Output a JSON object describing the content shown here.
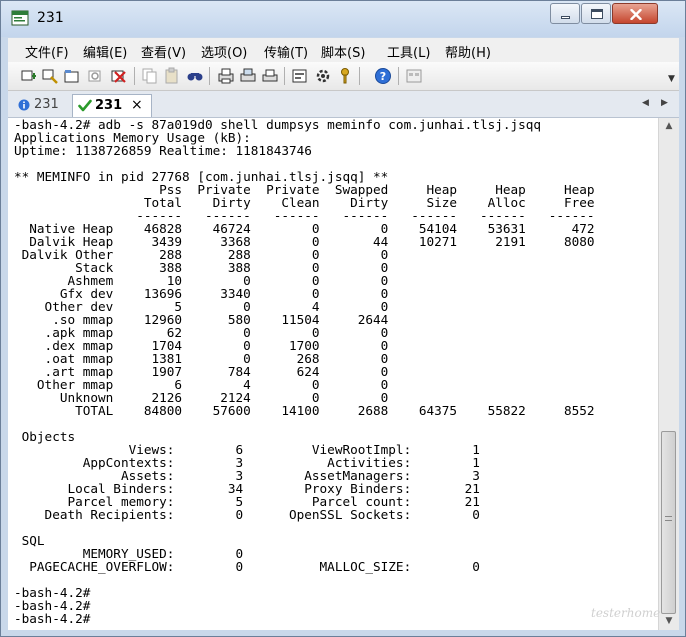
{
  "window": {
    "title": "231"
  },
  "menu": [
    "文件(F)",
    "编辑(E)",
    "查看(V)",
    "选项(O)",
    "传输(T)",
    "脚本(S)",
    "工具(L)",
    "帮助(H)"
  ],
  "tabs": [
    {
      "label": "231",
      "active": false
    },
    {
      "label": "231",
      "active": true,
      "close": "×"
    }
  ],
  "terminal": {
    "lines": [
      "-bash-4.2# adb -s 87a019d0 shell dumpsys meminfo com.junhai.tlsj.jsqq",
      "Applications Memory Usage (kB):",
      "Uptime: 1138726859 Realtime: 1181843746",
      "",
      "** MEMINFO in pid 27768 [com.junhai.tlsj.jsqq] **",
      "                   Pss  Private  Private  Swapped     Heap     Heap     Heap",
      "                 Total    Dirty    Clean    Dirty     Size    Alloc     Free",
      "                ------   ------   ------   ------   ------   ------   ------",
      "  Native Heap    46828    46724        0        0    54104    53631      472",
      "  Dalvik Heap     3439     3368        0       44    10271     2191     8080",
      " Dalvik Other      288      288        0        0",
      "        Stack      388      388        0        0",
      "       Ashmem       10        0        0        0",
      "      Gfx dev    13696     3340        0        0",
      "    Other dev        5        0        4        0",
      "     .so mmap    12960      580    11504     2644",
      "    .apk mmap       62        0        0        0",
      "    .dex mmap     1704        0     1700        0",
      "    .oat mmap     1381        0      268        0",
      "    .art mmap     1907      784      624        0",
      "   Other mmap        6        4        0        0",
      "      Unknown     2126     2124        0        0",
      "        TOTAL    84800    57600    14100     2688    64375    55822     8552",
      "",
      " Objects",
      "               Views:        6         ViewRootImpl:        1",
      "         AppContexts:        3           Activities:        1",
      "              Assets:        3        AssetManagers:        3",
      "       Local Binders:       34        Proxy Binders:       21",
      "       Parcel memory:        5         Parcel count:       21",
      "    Death Recipients:        0      OpenSSL Sockets:        0",
      "",
      " SQL",
      "         MEMORY_USED:        0",
      "  PAGECACHE_OVERFLOW:        0          MALLOC_SIZE:        0",
      "",
      "-bash-4.2#",
      "-bash-4.2#",
      "-bash-4.2#"
    ]
  },
  "watermark": "testerhome"
}
